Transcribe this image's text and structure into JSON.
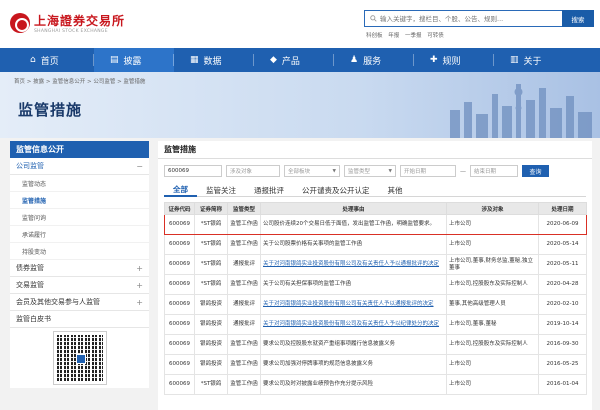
{
  "header": {
    "logo_cn": "上海證券交易所",
    "logo_en": "SHANGHAI STOCK EXCHANGE",
    "search_placeholder": "输入关键字，搜栏目、个股、公告、规则...",
    "search_button": "搜索",
    "hot_links": [
      "科创板",
      "年报",
      "一季报",
      "可转债"
    ]
  },
  "nav": [
    {
      "icon": "home-icon",
      "glyph": "⌂",
      "label": "首页"
    },
    {
      "icon": "disclosure-icon",
      "glyph": "▤",
      "label": "披露",
      "active": true
    },
    {
      "icon": "data-icon",
      "glyph": "▦",
      "label": "数据"
    },
    {
      "icon": "product-icon",
      "glyph": "◆",
      "label": "产品"
    },
    {
      "icon": "service-icon",
      "glyph": "♟",
      "label": "服务"
    },
    {
      "icon": "rules-icon",
      "glyph": "✚",
      "label": "规则"
    },
    {
      "icon": "about-icon",
      "glyph": "▥",
      "label": "关于"
    }
  ],
  "breadcrumb": "首页 > 披露 > 监管信息公开 > 公司监管 > 监管措施",
  "page_title": "监管措施",
  "sidebar": {
    "head": "监管信息公开",
    "items": [
      {
        "label": "公司监管",
        "open": true,
        "toggle": "−",
        "children": [
          "监管动态",
          "监管措施",
          "监管问询",
          "承诺履行",
          "持股变动"
        ],
        "active_child": 1
      },
      {
        "label": "债券监管",
        "toggle": "+"
      },
      {
        "label": "交易监管",
        "toggle": "+"
      },
      {
        "label": "会员及其他交易参与人监管",
        "toggle": "+"
      },
      {
        "label": "监管白皮书",
        "toggle": ""
      }
    ]
  },
  "content": {
    "title": "监管措施",
    "filters": {
      "code": "600069",
      "target": "涉及对象",
      "board": "全部板块",
      "type": "监管类型",
      "start": "开始日期",
      "dash": "—",
      "end": "结束日期",
      "query": "查询"
    },
    "tabs": [
      "全部",
      "监管关注",
      "通报批评",
      "公开谴责及公开认定",
      "其他"
    ],
    "columns": [
      "证券代码",
      "证券简称",
      "监管类型",
      "处理事由",
      "涉及对象",
      "处理日期"
    ],
    "rows": [
      {
        "code": "600069",
        "name": "*ST银鸽",
        "type": "监管工作函",
        "reason": "公司股价连续20个交易日低于面值，发出监管工作函，明确监管要求。",
        "target": "上市公司",
        "date": "2020-06-09",
        "highlight": true
      },
      {
        "code": "600069",
        "name": "*ST银鸽",
        "type": "监管工作函",
        "reason": "关于公司股票价格有关事项的监管工作函",
        "target": "上市公司",
        "date": "2020-05-14"
      },
      {
        "code": "600069",
        "name": "*ST银鸽",
        "type": "通报批评",
        "reason": "关于对河南银鸽实业投资股份有限公司及有关责任人予以通报批评的决定",
        "target": "上市公司,董事,财务总监,董秘,独立董事",
        "date": "2020-05-11",
        "link": true
      },
      {
        "code": "600069",
        "name": "*ST银鸽",
        "type": "监管工作函",
        "reason": "关于公司有关担保事项的监管工作函",
        "target": "上市公司,控股股东及实际控制人",
        "date": "2020-04-28"
      },
      {
        "code": "600069",
        "name": "银鸽投资",
        "type": "通报批评",
        "reason": "关于对河南银鸽实业投资股份有限公司有关责任人予以通报批评的决定",
        "target": "董事,其他高级管理人员",
        "date": "2020-02-10",
        "link": true
      },
      {
        "code": "600069",
        "name": "银鸽投资",
        "type": "通报批评",
        "reason": "关于对河南银鸽实业投资股份有限公司及有关责任人予以纪律处分的决定",
        "target": "上市公司,董事,董秘",
        "date": "2019-10-14",
        "link": true
      },
      {
        "code": "600069",
        "name": "银鸽投资",
        "type": "监管工作函",
        "reason": "要求公司及控股股东就资产重组事项履行信息披露义务",
        "target": "上市公司,控股股东及实际控制人",
        "date": "2016-09-30"
      },
      {
        "code": "600069",
        "name": "银鸽投资",
        "type": "监管工作函",
        "reason": "要求公司加强对停牌事项的规范信息披露义务",
        "target": "上市公司",
        "date": "2016-05-25"
      },
      {
        "code": "600069",
        "name": "*ST银鸽",
        "type": "监管工作函",
        "reason": "要求公司及时对披露业绩预告作充分提示风险",
        "target": "上市公司",
        "date": "2016-01-04"
      }
    ]
  },
  "colors": {
    "brand_blue": "#1f60b0",
    "brand_red": "#c8161d",
    "highlight_red": "#d93025"
  }
}
